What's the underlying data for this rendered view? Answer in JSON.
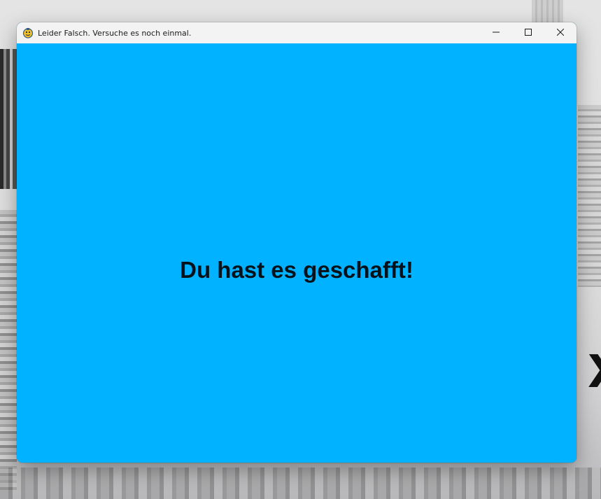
{
  "window": {
    "title": "Leider Falsch. Versuche es noch einmal.",
    "app_icon": "pygame-snake-icon",
    "controls": {
      "minimize_icon": "minimize-icon",
      "maximize_icon": "maximize-icon",
      "close_icon": "close-icon"
    }
  },
  "content": {
    "message": "Du hast es geschafft!",
    "background_color": "#00b2ff",
    "text_color": "#05121a"
  },
  "background": {
    "glyph": "X"
  }
}
